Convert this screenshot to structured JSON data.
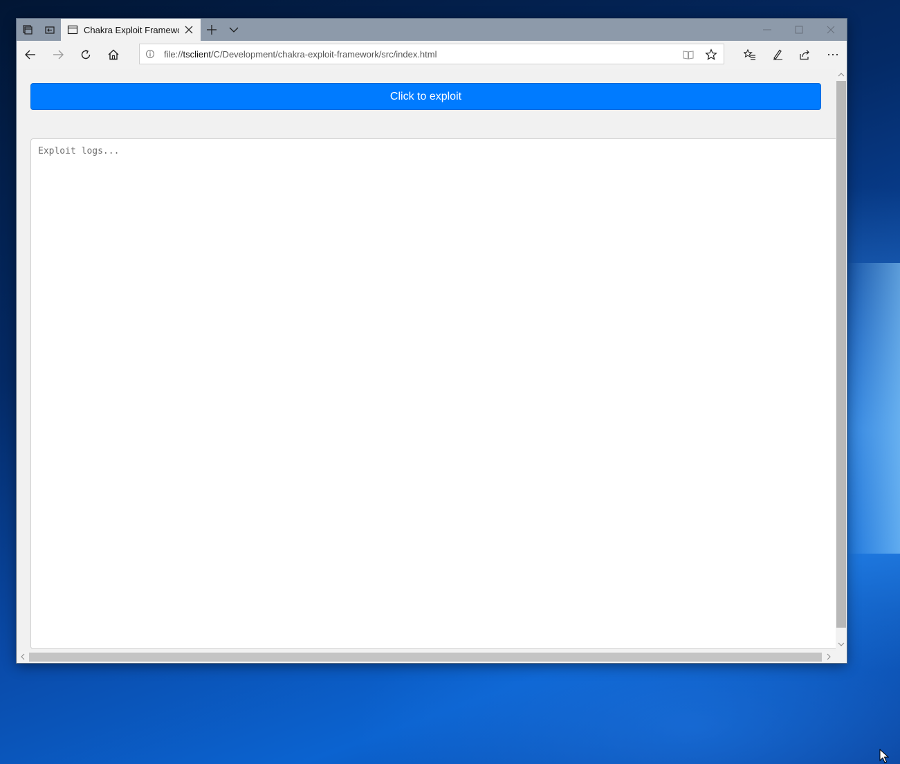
{
  "browser": {
    "tab": {
      "title": "Chakra Exploit Framewc"
    },
    "address": {
      "scheme": "file://",
      "host": "tsclient",
      "path": "/C/Development/chakra-exploit-framework/src/index.html"
    }
  },
  "page": {
    "button_label": "Click to exploit",
    "log_placeholder": "Exploit logs..."
  },
  "colors": {
    "primary_button": "#007bff",
    "titlebar": "#8d9aaa"
  }
}
